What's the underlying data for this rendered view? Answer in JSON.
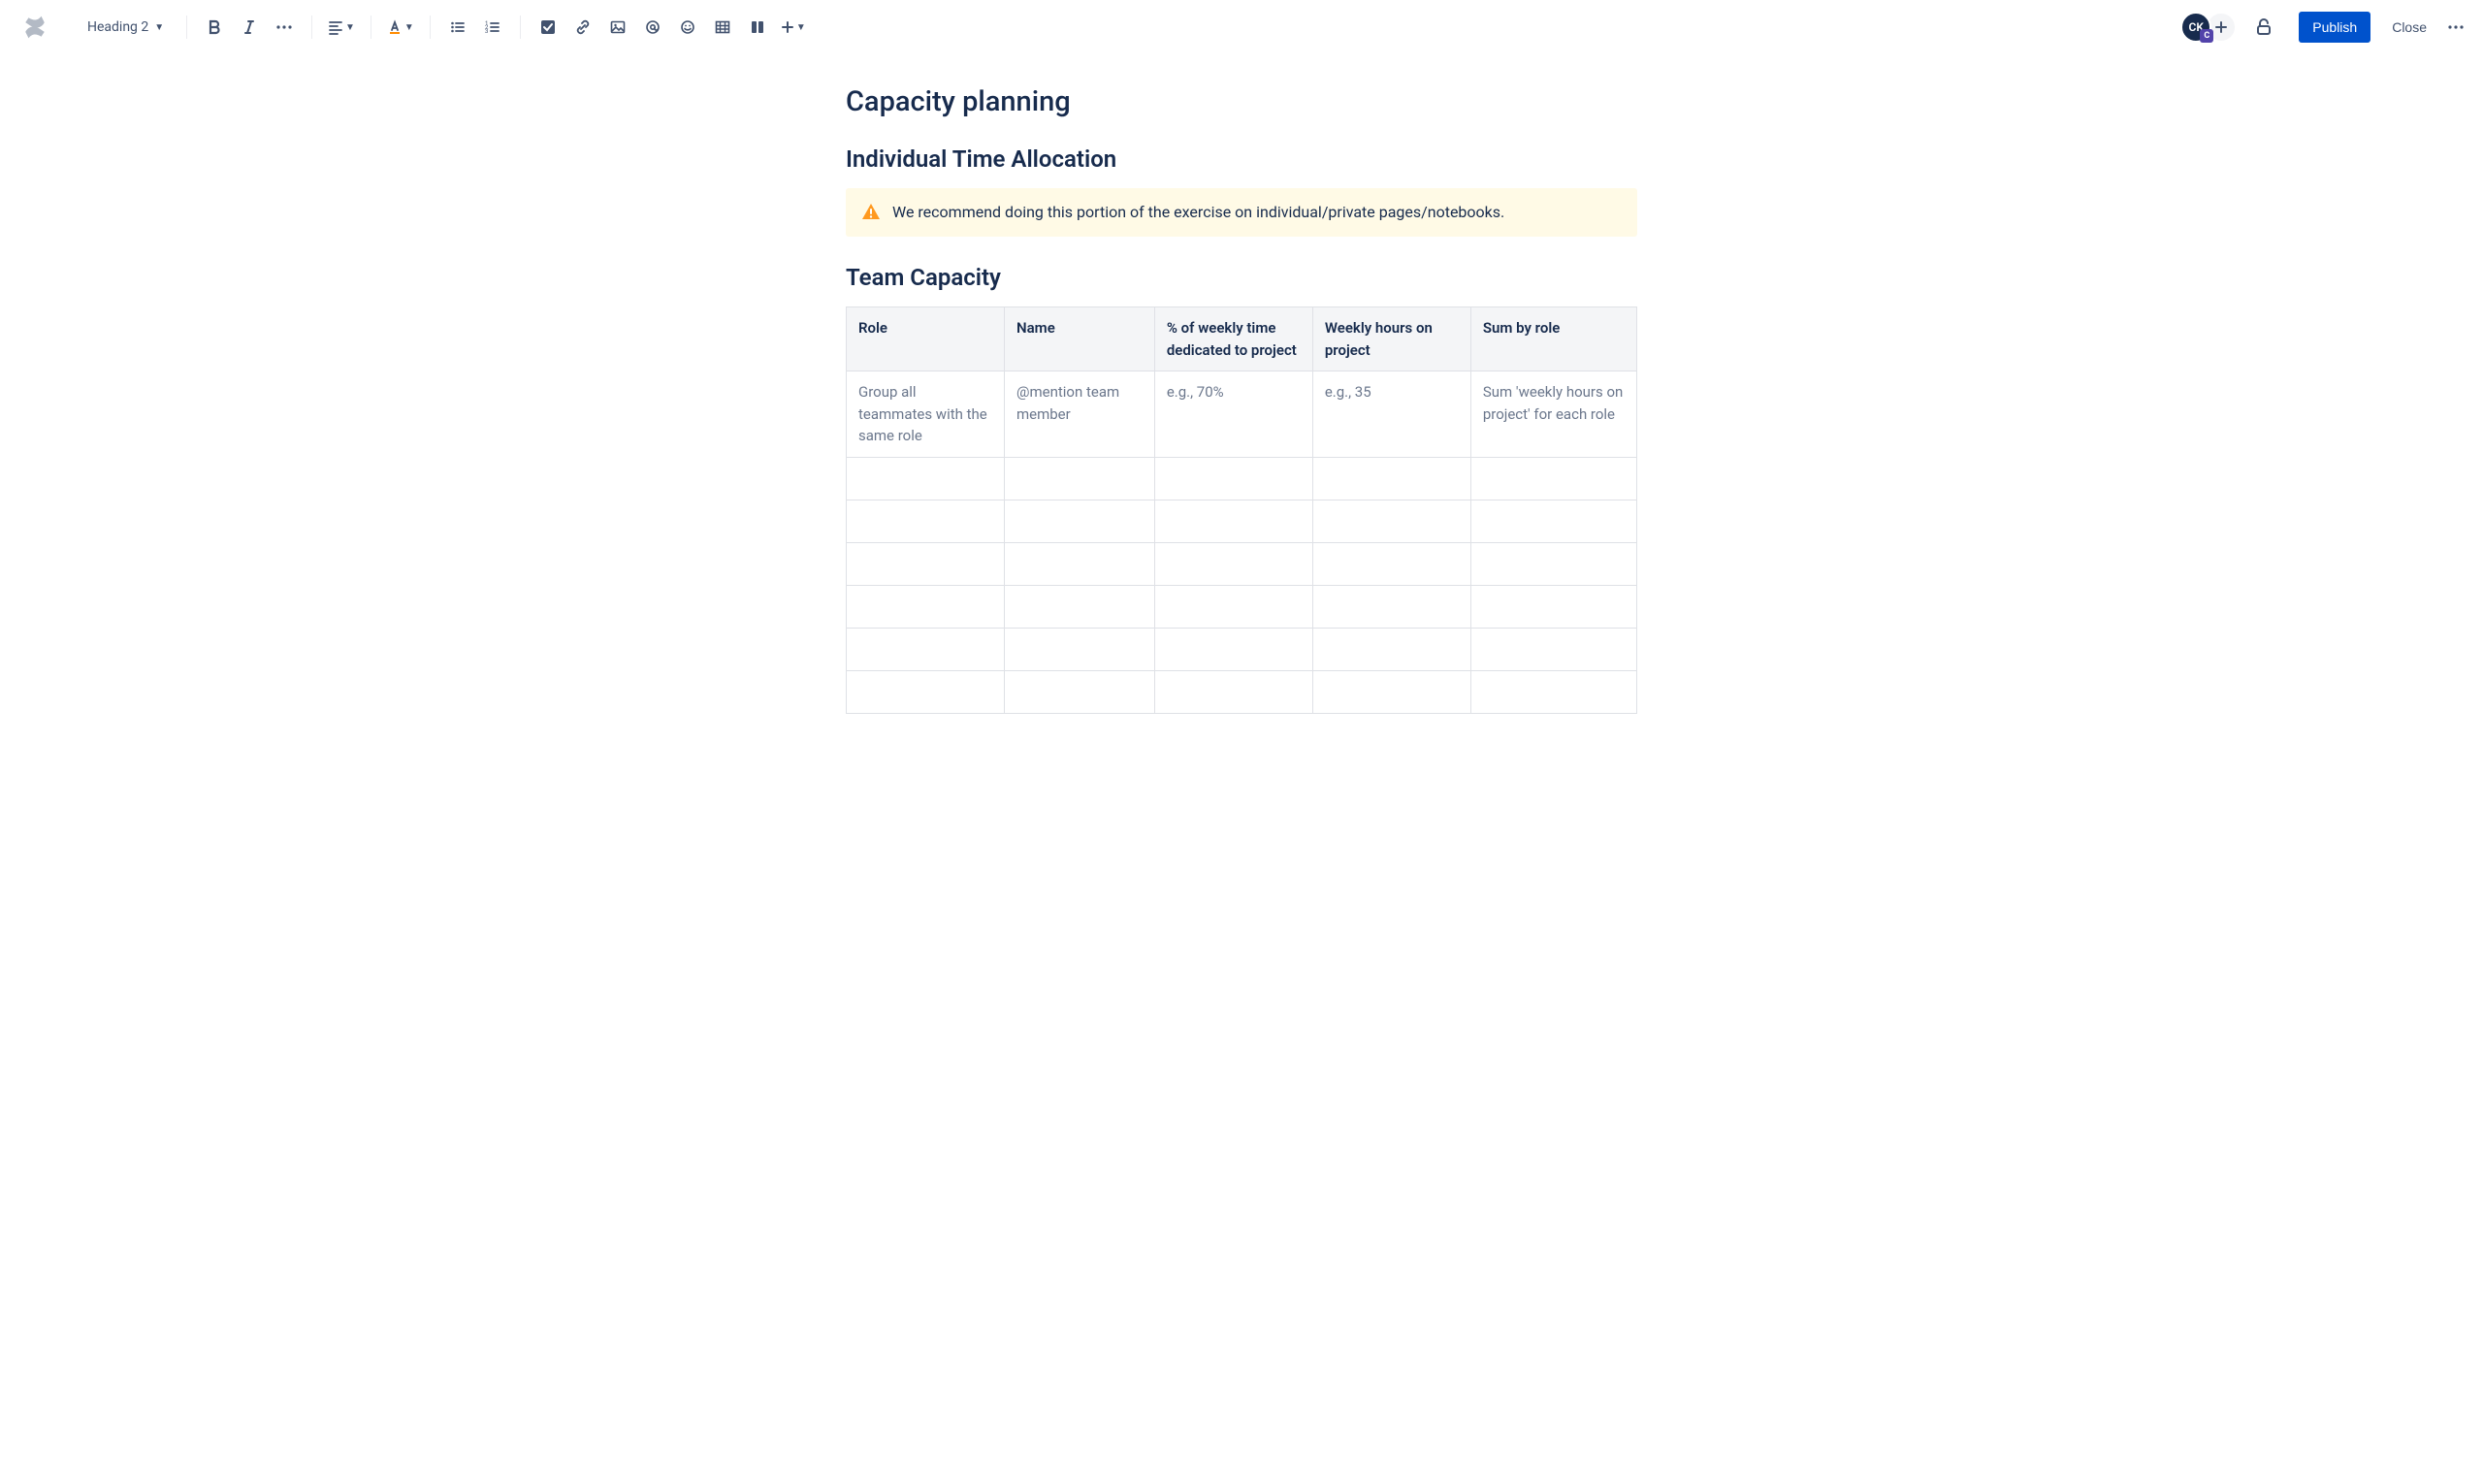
{
  "toolbar": {
    "heading_style_label": "Heading 2",
    "avatar_initials": "CK",
    "avatar_badge": "C",
    "publish_label": "Publish",
    "close_label": "Close"
  },
  "page": {
    "title": "Capacity planning",
    "sections": {
      "individual": {
        "heading": "Individual Time Allocation",
        "warning_text": "We recommend doing this portion of the exercise on individual/private pages/notebooks."
      },
      "team": {
        "heading": "Team Capacity"
      }
    }
  },
  "table": {
    "headers": [
      "Role",
      "Name",
      "% of weekly time dedicated to project",
      "Weekly hours on project",
      "Sum by role"
    ],
    "rows": [
      [
        "Group all teammates with the same role",
        "@mention team member",
        "e.g., 70%",
        "e.g., 35",
        "Sum 'weekly hours on project' for each role"
      ],
      [
        "",
        "",
        "",
        "",
        ""
      ],
      [
        "",
        "",
        "",
        "",
        ""
      ],
      [
        "",
        "",
        "",
        "",
        ""
      ],
      [
        "",
        "",
        "",
        "",
        ""
      ],
      [
        "",
        "",
        "",
        "",
        ""
      ],
      [
        "",
        "",
        "",
        "",
        ""
      ]
    ]
  }
}
